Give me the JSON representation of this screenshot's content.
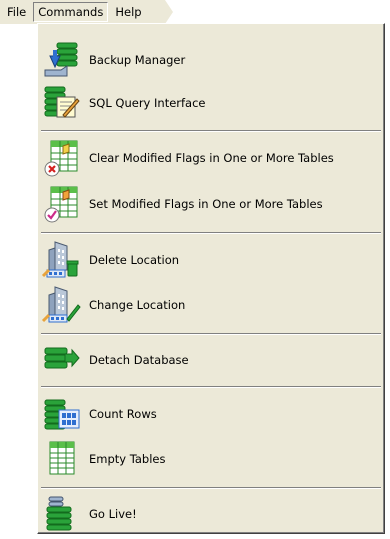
{
  "menubar": {
    "file": "File",
    "commands": "Commands",
    "help": "Help"
  },
  "commands_menu": {
    "items": [
      {
        "label": "Backup Manager",
        "icon": "backup-manager-icon"
      },
      {
        "label": "SQL Query Interface",
        "icon": "sql-query-icon"
      },
      {
        "label": "Clear Modified Flags in One or More Tables",
        "icon": "clear-flags-icon"
      },
      {
        "label": "Set Modified Flags in One or More Tables",
        "icon": "set-flags-icon"
      },
      {
        "label": "Delete Location",
        "icon": "delete-location-icon"
      },
      {
        "label": "Change Location",
        "icon": "change-location-icon"
      },
      {
        "label": "Detach Database",
        "icon": "detach-database-icon"
      },
      {
        "label": "Count Rows",
        "icon": "count-rows-icon"
      },
      {
        "label": "Empty Tables",
        "icon": "empty-tables-icon"
      },
      {
        "label": "Go Live!",
        "icon": "go-live-icon"
      }
    ]
  },
  "colors": {
    "menu_bg": "#ece9d8",
    "db_green": "#2aa33a",
    "db_dark": "#136b1d",
    "table_green": "#5bbf4a"
  }
}
